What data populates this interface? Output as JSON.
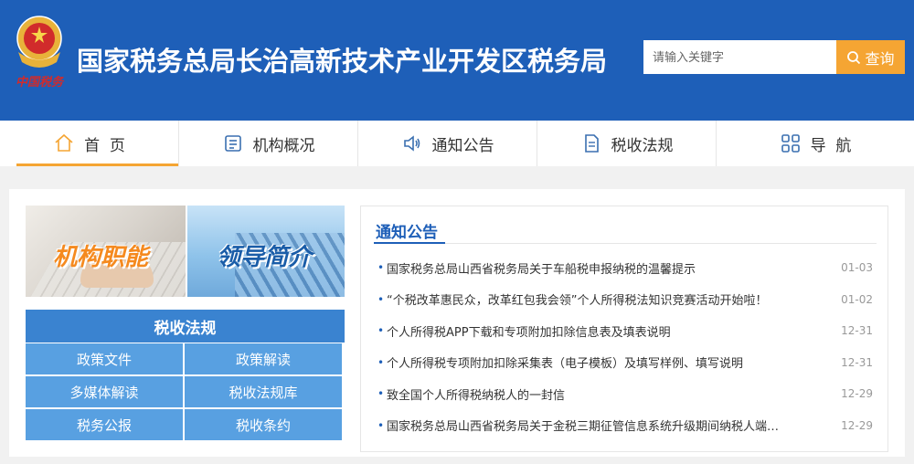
{
  "header": {
    "title": "国家税务总局长治高新技术产业开发区税务局",
    "emblem_caption": "中国税务",
    "search": {
      "placeholder": "请输入关键字",
      "button_label": "查询"
    }
  },
  "nav": [
    {
      "label": "首  页",
      "icon": "home-icon"
    },
    {
      "label": "机构概况",
      "icon": "building-icon"
    },
    {
      "label": "通知公告",
      "icon": "speaker-icon"
    },
    {
      "label": "税收法规",
      "icon": "document-icon"
    },
    {
      "label": "导  航",
      "icon": "grid-icon"
    }
  ],
  "promos": [
    {
      "label": "机构职能"
    },
    {
      "label": "领导简介"
    }
  ],
  "law_panel": {
    "title": "税收法规",
    "items": [
      "政策文件",
      "政策解读",
      "多媒体解读",
      "税收法规库",
      "税务公报",
      "税收条约"
    ]
  },
  "notices": {
    "title": "通知公告",
    "items": [
      {
        "title": "国家税务总局山西省税务局关于车船税申报纳税的温馨提示",
        "date": "01-03"
      },
      {
        "title": "“个税改革惠民众，改革红包我会领”个人所得税法知识竞赛活动开始啦！",
        "date": "01-02"
      },
      {
        "title": "个人所得税APP下载和专项附加扣除信息表及填表说明",
        "date": "12-31"
      },
      {
        "title": "个人所得税专项附加扣除采集表（电子模板）及填写样例、填写说明",
        "date": "12-31"
      },
      {
        "title": "致全国个人所得税纳税人的一封信",
        "date": "12-29"
      },
      {
        "title": "国家税务总局山西省税务局关于金税三期征管信息系统升级期间纳税人端…",
        "date": "12-29"
      }
    ]
  },
  "colors": {
    "header_blue": "#1e5fb8",
    "accent_orange": "#f5a533",
    "panel_blue": "#58a0e1"
  }
}
